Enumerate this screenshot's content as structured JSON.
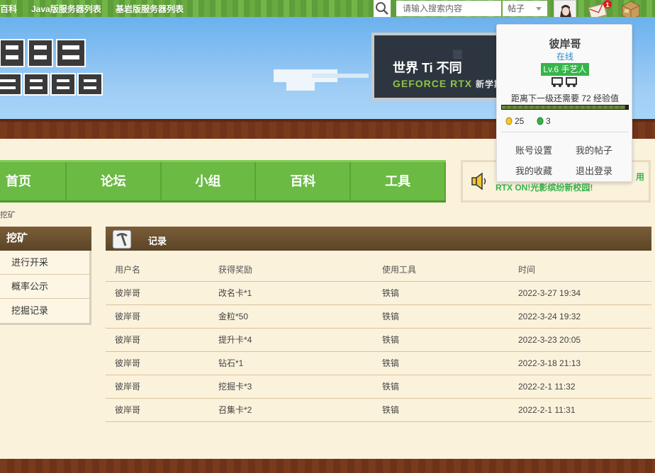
{
  "topbar": {
    "links": [
      "百科",
      "Java版服务器列表",
      "基岩版服务器列表"
    ],
    "search_placeholder": "请输入搜索内容",
    "search_type": "帖子"
  },
  "banner": {
    "ad_title": "世界 Ti 不同",
    "ad_brand": "GEFORCE RTX",
    "ad_suffix": "新学期"
  },
  "nav": {
    "items": [
      "首页",
      "论坛",
      "小组",
      "百科",
      "工具"
    ]
  },
  "announcement": {
    "text": "RTX ON!光影缤纷新校园!",
    "tail": "用"
  },
  "breadcrumb": "挖矿",
  "sidebar": {
    "title": "挖矿",
    "items": [
      "进行开采",
      "概率公示",
      "挖掘记录"
    ]
  },
  "records": {
    "title": "记录",
    "columns": [
      "用户名",
      "获得奖励",
      "使用工具",
      "时间"
    ],
    "rows": [
      [
        "彼岸哥",
        "改名卡*1",
        "铁镐",
        "2022-3-27 19:34"
      ],
      [
        "彼岸哥",
        "金粒*50",
        "铁镐",
        "2022-3-24 19:32"
      ],
      [
        "彼岸哥",
        "提升卡*4",
        "铁镐",
        "2022-3-23 20:05"
      ],
      [
        "彼岸哥",
        "钻石*1",
        "铁镐",
        "2022-3-18 21:13"
      ],
      [
        "彼岸哥",
        "挖掘卡*3",
        "铁镐",
        "2022-2-1 11:32"
      ],
      [
        "彼岸哥",
        "召集卡*2",
        "铁镐",
        "2022-2-1 11:31"
      ]
    ]
  },
  "user_popup": {
    "username": "彼岸哥",
    "status": "在线",
    "level": "Lv.6 手艺人",
    "exp_text": "距离下一级还需要 72 经验值",
    "exp_progress": 0.98,
    "gold": "25",
    "gems": "3",
    "links": [
      "账号设置",
      "我的帖子",
      "我的收藏",
      "退出登录"
    ]
  },
  "notification_count": "1",
  "colors": {
    "grass": "#6aba44",
    "dirt": "#7a3a1c",
    "panel_header": "#5b4426",
    "accent_green": "#36b44a",
    "link_blue": "#2a8acb"
  }
}
